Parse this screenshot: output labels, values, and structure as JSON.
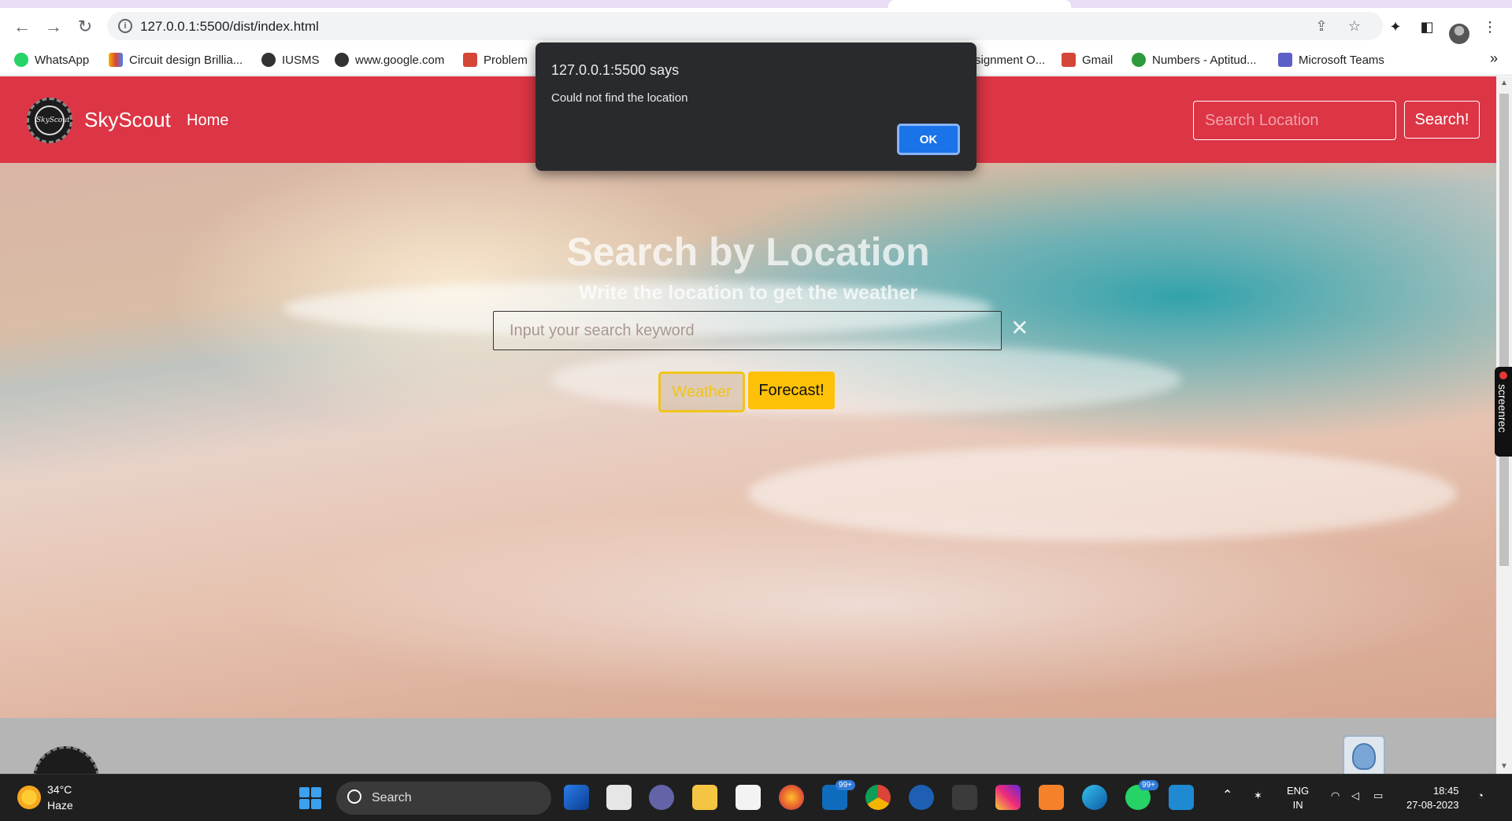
{
  "browser": {
    "url": "127.0.0.1:5500/dist/index.html",
    "bookmarks": [
      {
        "label": "WhatsApp",
        "color": "#25d366"
      },
      {
        "label": "Circuit design Brillia...",
        "color": "#f4b400"
      },
      {
        "label": "IUSMS",
        "color": "#333333"
      },
      {
        "label": "www.google.com",
        "color": "#333333"
      },
      {
        "label": "Problem",
        "color": "#d44638"
      },
      {
        "label": "signment O...",
        "color": "#d44638"
      },
      {
        "label": "Gmail",
        "color": "#d44638"
      },
      {
        "label": "Numbers - Aptitud...",
        "color": "#2e9a3b"
      },
      {
        "label": "Microsoft Teams",
        "color": "#5b5fc7"
      }
    ],
    "more": "»"
  },
  "navbar": {
    "brand": "SkyScout",
    "logo_text": "SkyScout",
    "home": "Home",
    "search_placeholder": "Search Location",
    "search_button": "Search!",
    "color": "#dc3545"
  },
  "hero": {
    "title": "Search by Location",
    "subtitle": "Write the location to get the weather",
    "input_placeholder": "Input your search keyword",
    "clear": "✕",
    "weather_button": "Weather",
    "forecast_button": "Forecast!"
  },
  "dialog": {
    "title": "127.0.0.1:5500 says",
    "message": "Could not find the location",
    "ok": "OK"
  },
  "screenrec": "screenrec",
  "taskbar": {
    "temperature": "34°C",
    "condition": "Haze",
    "search": "Search",
    "badge_mail": "99+",
    "badge_whatsapp": "99+",
    "lang": "ENG",
    "region": "IN",
    "time": "18:45",
    "date": "27-08-2023"
  }
}
